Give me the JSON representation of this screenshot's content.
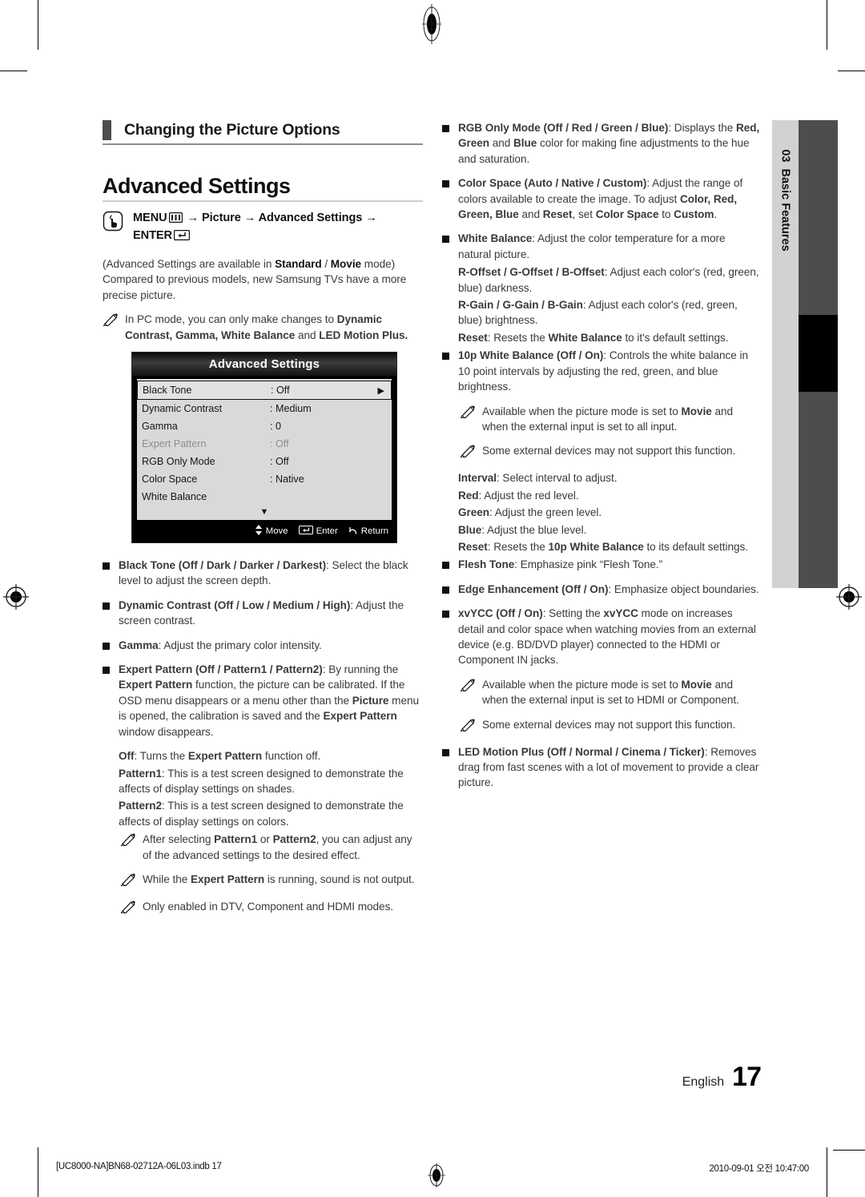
{
  "page": {
    "language_label": "English",
    "page_number": "17",
    "chapter_number": "03",
    "chapter_title": "Basic Features"
  },
  "footer": {
    "file": "[UC8000-NA]BN68-02712A-06L03.indb   17",
    "timestamp": "2010-09-01   오전 10:47:00"
  },
  "left": {
    "section_heading": "Changing the Picture Options",
    "h1": "Advanced Settings",
    "menu_path": {
      "prefix": "MENU",
      "menu_icon": "menu-bars-icon",
      "steps": " → Picture → Advanced Settings → ",
      "enter": "ENTER",
      "enter_icon": "enter-key-icon"
    },
    "intro_1_a": "(Advanced Settings are available in ",
    "intro_1_b": "Standard",
    "intro_1_c": " / ",
    "intro_1_d": "Movie",
    "intro_1_e": " mode)",
    "intro_2": "Compared to previous models, new Samsung TVs have a more precise picture.",
    "note_pc_a": "In PC mode, you can only make changes to ",
    "note_pc_b": "Dynamic Contrast, Gamma, White Balance",
    "note_pc_c": " and ",
    "note_pc_d": "LED Motion Plus",
    "note_pc_e": ".",
    "osd": {
      "title": "Advanced Settings",
      "rows": [
        {
          "label": "Black Tone",
          "value": ": Off",
          "selected": true,
          "disabled": false,
          "arrow": "▶"
        },
        {
          "label": "Dynamic Contrast",
          "value": ": Medium",
          "selected": false,
          "disabled": false,
          "arrow": ""
        },
        {
          "label": "Gamma",
          "value": ": 0",
          "selected": false,
          "disabled": false,
          "arrow": ""
        },
        {
          "label": "Expert Pattern",
          "value": ": Off",
          "selected": false,
          "disabled": true,
          "arrow": ""
        },
        {
          "label": "RGB Only Mode",
          "value": ": Off",
          "selected": false,
          "disabled": false,
          "arrow": ""
        },
        {
          "label": "Color Space",
          "value": ": Native",
          "selected": false,
          "disabled": false,
          "arrow": ""
        },
        {
          "label": "White Balance",
          "value": "",
          "selected": false,
          "disabled": false,
          "arrow": ""
        }
      ],
      "scroll_down": "▼",
      "footer": {
        "move": "Move",
        "enter": "Enter",
        "return": "Return"
      }
    },
    "bullets": [
      {
        "title": "Black Tone (Off / Dark / Darker / Darkest)",
        "body": ": Select the black level to adjust the screen depth."
      },
      {
        "title": "Dynamic Contrast (Off / Low / Medium / High)",
        "body": ": Adjust the screen contrast."
      },
      {
        "title": "Gamma",
        "body": ": Adjust the primary color intensity."
      }
    ],
    "expert": {
      "title": "Expert Pattern (Off / Pattern1 / Pattern2)",
      "body_1": ": By running the ",
      "body_2": "Expert Pattern",
      "body_3": " function, the picture can be calibrated. If the OSD menu disappears or a menu other than the ",
      "body_4": "Picture",
      "body_5": " menu is opened, the calibration is saved and the ",
      "body_6": "Expert Pattern",
      "body_7": " window disappears."
    },
    "expert_values": [
      {
        "term": "Off",
        "text": ": Turns the ",
        "term2": "Expert Pattern",
        "text2": " function off."
      },
      {
        "term": "Pattern1",
        "text": ": This is a test screen designed to demonstrate the affects of display settings on shades.",
        "term2": "",
        "text2": ""
      },
      {
        "term": "Pattern2",
        "text": ": This is a test screen designed to demonstrate the affects of display settings on colors.",
        "term2": "",
        "text2": ""
      }
    ],
    "expert_notes": [
      {
        "a": "After selecting ",
        "b": "Pattern1",
        "c": " or ",
        "d": "Pattern2",
        "e": ", you can adjust any of the advanced settings to the desired effect."
      },
      {
        "a": "While the ",
        "b": "Expert Pattern",
        "c": "",
        "d": "",
        "e": " is running, sound is not output."
      },
      {
        "a": "Only enabled in DTV, Component and HDMI modes.",
        "b": "",
        "c": "",
        "d": "",
        "e": ""
      }
    ]
  },
  "right": {
    "rgb_only": {
      "title": "RGB Only Mode (Off / Red / Green / Blue)",
      "p1": ": Displays the ",
      "p2": "Red, Green",
      "p3": " and ",
      "p4": "Blue",
      "p5": " color for making fine adjustments to the hue and saturation."
    },
    "color_space": {
      "title": "Color Space (Auto / Native / Custom)",
      "p1": ": Adjust the range of colors available to create the image. To adjust ",
      "p2": "Color, Red, Green, Blue",
      "p3": " and ",
      "p4": "Reset",
      "p5": ", set ",
      "p6": "Color Space",
      "p7": " to ",
      "p8": "Custom",
      "p9": "."
    },
    "white_balance": {
      "title": "White Balance",
      "body": ": Adjust the color temperature for a more natural picture.",
      "offset_term": "R-Offset / G-Offset / B-Offset",
      "offset_text": ": Adjust each color's (red, green, blue) darkness.",
      "gain_term": "R-Gain / G-Gain / B-Gain",
      "gain_text": ": Adjust each color's (red, green, blue) brightness.",
      "reset_term": "Reset",
      "reset_text_a": ": Resets the ",
      "reset_term_b": "White Balance",
      "reset_text_b": " to it's default settings."
    },
    "wb10p": {
      "title": "10p White Balance (Off / On)",
      "body": ": Controls the white balance in 10 point intervals by adjusting the red, green, and blue brightness.",
      "notes": [
        {
          "a": "Available when the picture mode is set to ",
          "b": "Movie",
          "c": " and when the external input is set to all input."
        },
        {
          "a": "Some external devices may not support this function.",
          "b": "",
          "c": ""
        }
      ],
      "items": [
        {
          "term": "Interval",
          "text": ": Select interval to adjust."
        },
        {
          "term": "Red",
          "text": ": Adjust the red level."
        },
        {
          "term": "Green",
          "text": ": Adjust the green level."
        },
        {
          "term": "Blue",
          "text": ": Adjust the blue level."
        }
      ],
      "reset_term": "Reset",
      "reset_text_a": ": Resets the ",
      "reset_term_b": "10p White Balance",
      "reset_text_b": " to its default settings."
    },
    "flesh_tone": {
      "title": "Flesh Tone",
      "body": ": Emphasize pink “Flesh Tone.”"
    },
    "edge_enhancement": {
      "title": "Edge Enhancement (Off / On)",
      "body": ": Emphasize object boundaries."
    },
    "xvycc": {
      "title": "xvYCC (Off / On)",
      "p1": ": Setting the ",
      "p2": "xvYCC",
      "p3": " mode on increases detail and color space when watching movies from an external device (e.g. BD/DVD player) connected to the HDMI or Component IN jacks.",
      "notes": [
        {
          "a": "Available when the picture mode is set to ",
          "b": "Movie",
          "c": " and when the external input is set to HDMI or Component."
        },
        {
          "a": "Some external devices may not support this function.",
          "b": "",
          "c": ""
        }
      ]
    },
    "led_motion_plus": {
      "title": "LED Motion Plus (Off / Normal / Cinema / Ticker)",
      "body": ": Removes drag from fast scenes with a lot of movement to provide a clear picture."
    }
  }
}
